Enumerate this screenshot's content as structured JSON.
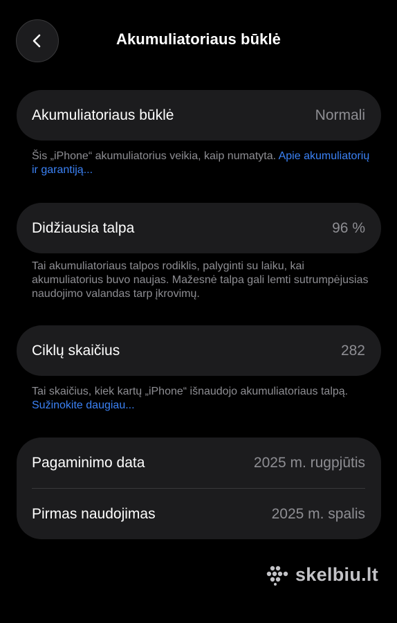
{
  "header": {
    "back_icon": "chevron-left-icon",
    "title": "Akumuliatoriaus būklė"
  },
  "battery_health": {
    "label": "Akumuliatoriaus būklė",
    "value": "Normali",
    "note_text": "Šis „iPhone“ akumuliatorius veikia, kaip numatyta. ",
    "note_link": "Apie akumuliatorių ir garantiją..."
  },
  "max_capacity": {
    "label": "Didžiausia talpa",
    "value": "96 %",
    "note_text": "Tai akumuliatoriaus talpos rodiklis, palyginti su laiku, kai akumuliatorius buvo naujas. Mažesnė talpa gali lemti sutrumpėjusias naudojimo valandas tarp įkrovimų."
  },
  "cycle_count": {
    "label": "Ciklų skaičius",
    "value": "282",
    "note_text": "Tai skaičius, kiek kartų „iPhone“ išnaudojo akumuliatoriaus talpą. ",
    "note_link": "Sužinokite daugiau..."
  },
  "dates": {
    "manufacture_label": "Pagaminimo data",
    "manufacture_value": "2025 m. rugpjūtis",
    "first_use_label": "Pirmas naudojimas",
    "first_use_value": "2025 m. spalis"
  },
  "watermark": {
    "icon": "skelbiu-logo-icon",
    "text": "skelbiu.lt"
  },
  "colors": {
    "background": "#000000",
    "card": "#1c1c1e",
    "secondary_text": "#8e8e93",
    "link": "#3b82f6"
  }
}
